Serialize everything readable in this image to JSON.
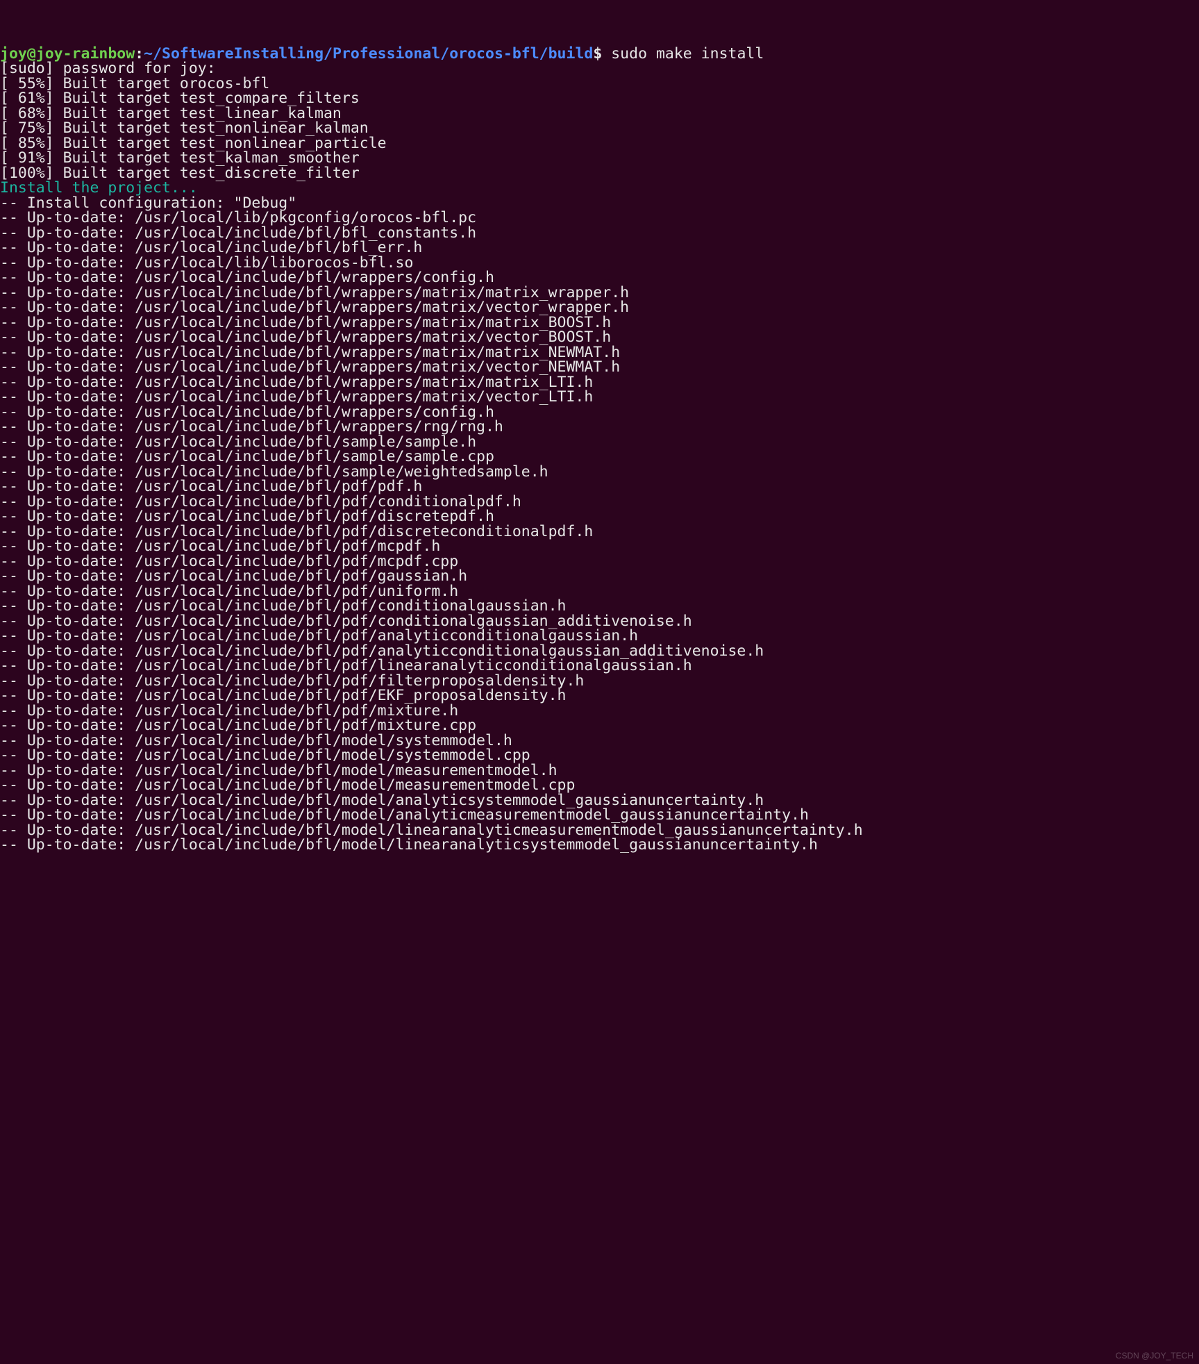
{
  "prompt": {
    "user_host": "joy@joy-rainbow",
    "colon": ":",
    "path": "~/SoftwareInstalling/Professional/orocos-bfl/build",
    "dollar": "$ ",
    "command": "sudo make install"
  },
  "lines": {
    "sudo": "[sudo] password for joy: ",
    "install_header": "Install the project...",
    "install_config": "-- Install configuration: \"Debug\""
  },
  "build": [
    "[ 55%] Built target orocos-bfl",
    "[ 61%] Built target test_compare_filters",
    "[ 68%] Built target test_linear_kalman",
    "[ 75%] Built target test_nonlinear_kalman",
    "[ 85%] Built target test_nonlinear_particle",
    "[ 91%] Built target test_kalman_smoother",
    "[100%] Built target test_discrete_filter"
  ],
  "uptodate": [
    "-- Up-to-date: /usr/local/lib/pkgconfig/orocos-bfl.pc",
    "-- Up-to-date: /usr/local/include/bfl/bfl_constants.h",
    "-- Up-to-date: /usr/local/include/bfl/bfl_err.h",
    "-- Up-to-date: /usr/local/lib/liborocos-bfl.so",
    "-- Up-to-date: /usr/local/include/bfl/wrappers/config.h",
    "-- Up-to-date: /usr/local/include/bfl/wrappers/matrix/matrix_wrapper.h",
    "-- Up-to-date: /usr/local/include/bfl/wrappers/matrix/vector_wrapper.h",
    "-- Up-to-date: /usr/local/include/bfl/wrappers/matrix/matrix_BOOST.h",
    "-- Up-to-date: /usr/local/include/bfl/wrappers/matrix/vector_BOOST.h",
    "-- Up-to-date: /usr/local/include/bfl/wrappers/matrix/matrix_NEWMAT.h",
    "-- Up-to-date: /usr/local/include/bfl/wrappers/matrix/vector_NEWMAT.h",
    "-- Up-to-date: /usr/local/include/bfl/wrappers/matrix/matrix_LTI.h",
    "-- Up-to-date: /usr/local/include/bfl/wrappers/matrix/vector_LTI.h",
    "-- Up-to-date: /usr/local/include/bfl/wrappers/config.h",
    "-- Up-to-date: /usr/local/include/bfl/wrappers/rng/rng.h",
    "-- Up-to-date: /usr/local/include/bfl/sample/sample.h",
    "-- Up-to-date: /usr/local/include/bfl/sample/sample.cpp",
    "-- Up-to-date: /usr/local/include/bfl/sample/weightedsample.h",
    "-- Up-to-date: /usr/local/include/bfl/pdf/pdf.h",
    "-- Up-to-date: /usr/local/include/bfl/pdf/conditionalpdf.h",
    "-- Up-to-date: /usr/local/include/bfl/pdf/discretepdf.h",
    "-- Up-to-date: /usr/local/include/bfl/pdf/discreteconditionalpdf.h",
    "-- Up-to-date: /usr/local/include/bfl/pdf/mcpdf.h",
    "-- Up-to-date: /usr/local/include/bfl/pdf/mcpdf.cpp",
    "-- Up-to-date: /usr/local/include/bfl/pdf/gaussian.h",
    "-- Up-to-date: /usr/local/include/bfl/pdf/uniform.h",
    "-- Up-to-date: /usr/local/include/bfl/pdf/conditionalgaussian.h",
    "-- Up-to-date: /usr/local/include/bfl/pdf/conditionalgaussian_additivenoise.h",
    "-- Up-to-date: /usr/local/include/bfl/pdf/analyticconditionalgaussian.h",
    "-- Up-to-date: /usr/local/include/bfl/pdf/analyticconditionalgaussian_additivenoise.h",
    "-- Up-to-date: /usr/local/include/bfl/pdf/linearanalyticconditionalgaussian.h",
    "-- Up-to-date: /usr/local/include/bfl/pdf/filterproposaldensity.h",
    "-- Up-to-date: /usr/local/include/bfl/pdf/EKF_proposaldensity.h",
    "-- Up-to-date: /usr/local/include/bfl/pdf/mixture.h",
    "-- Up-to-date: /usr/local/include/bfl/pdf/mixture.cpp",
    "-- Up-to-date: /usr/local/include/bfl/model/systemmodel.h",
    "-- Up-to-date: /usr/local/include/bfl/model/systemmodel.cpp",
    "-- Up-to-date: /usr/local/include/bfl/model/measurementmodel.h",
    "-- Up-to-date: /usr/local/include/bfl/model/measurementmodel.cpp",
    "-- Up-to-date: /usr/local/include/bfl/model/analyticsystemmodel_gaussianuncertainty.h",
    "-- Up-to-date: /usr/local/include/bfl/model/analyticmeasurementmodel_gaussianuncertainty.h",
    "-- Up-to-date: /usr/local/include/bfl/model/linearanalyticmeasurementmodel_gaussianuncertainty.h",
    "-- Up-to-date: /usr/local/include/bfl/model/linearanalyticsystemmodel_gaussianuncertainty.h"
  ],
  "watermark": "CSDN @JOY_TECH"
}
